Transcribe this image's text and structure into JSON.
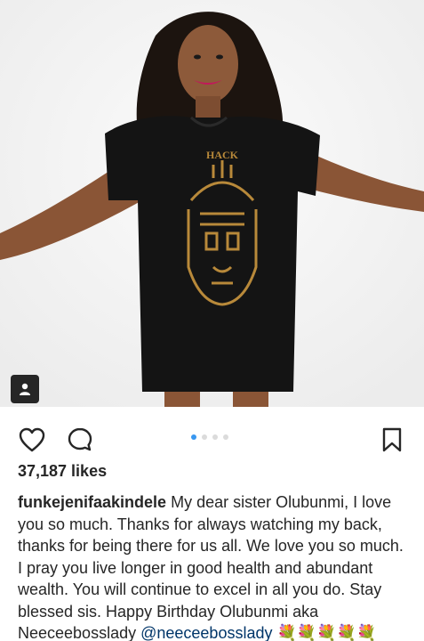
{
  "post": {
    "username": "funkejenifaakindele",
    "likes_text": "37,187 likes",
    "caption_text": "My dear sister Olubunmi, I love you so much. Thanks for always watching my back, thanks for being there for us all. We love you so much. I pray you live longer in good health and abundant wealth. You will continue to excel in all you do. Stay blessed sis. Happy Birthday Olubunmi aka Neeceebosslady",
    "mention": "@neeceebosslady",
    "emojis": "💐💐💐💐💐",
    "carousel": {
      "total": 4,
      "current": 1
    }
  },
  "photo": {
    "shirt_text": "HACK"
  },
  "icons": {
    "like": "heart-icon",
    "comment": "comment-icon",
    "save": "bookmark-icon",
    "tag": "person-tag-icon"
  },
  "colors": {
    "active_dot": "#3897f0",
    "inactive_dot": "#dbdbdb",
    "text": "#262626",
    "mention": "#003569"
  }
}
